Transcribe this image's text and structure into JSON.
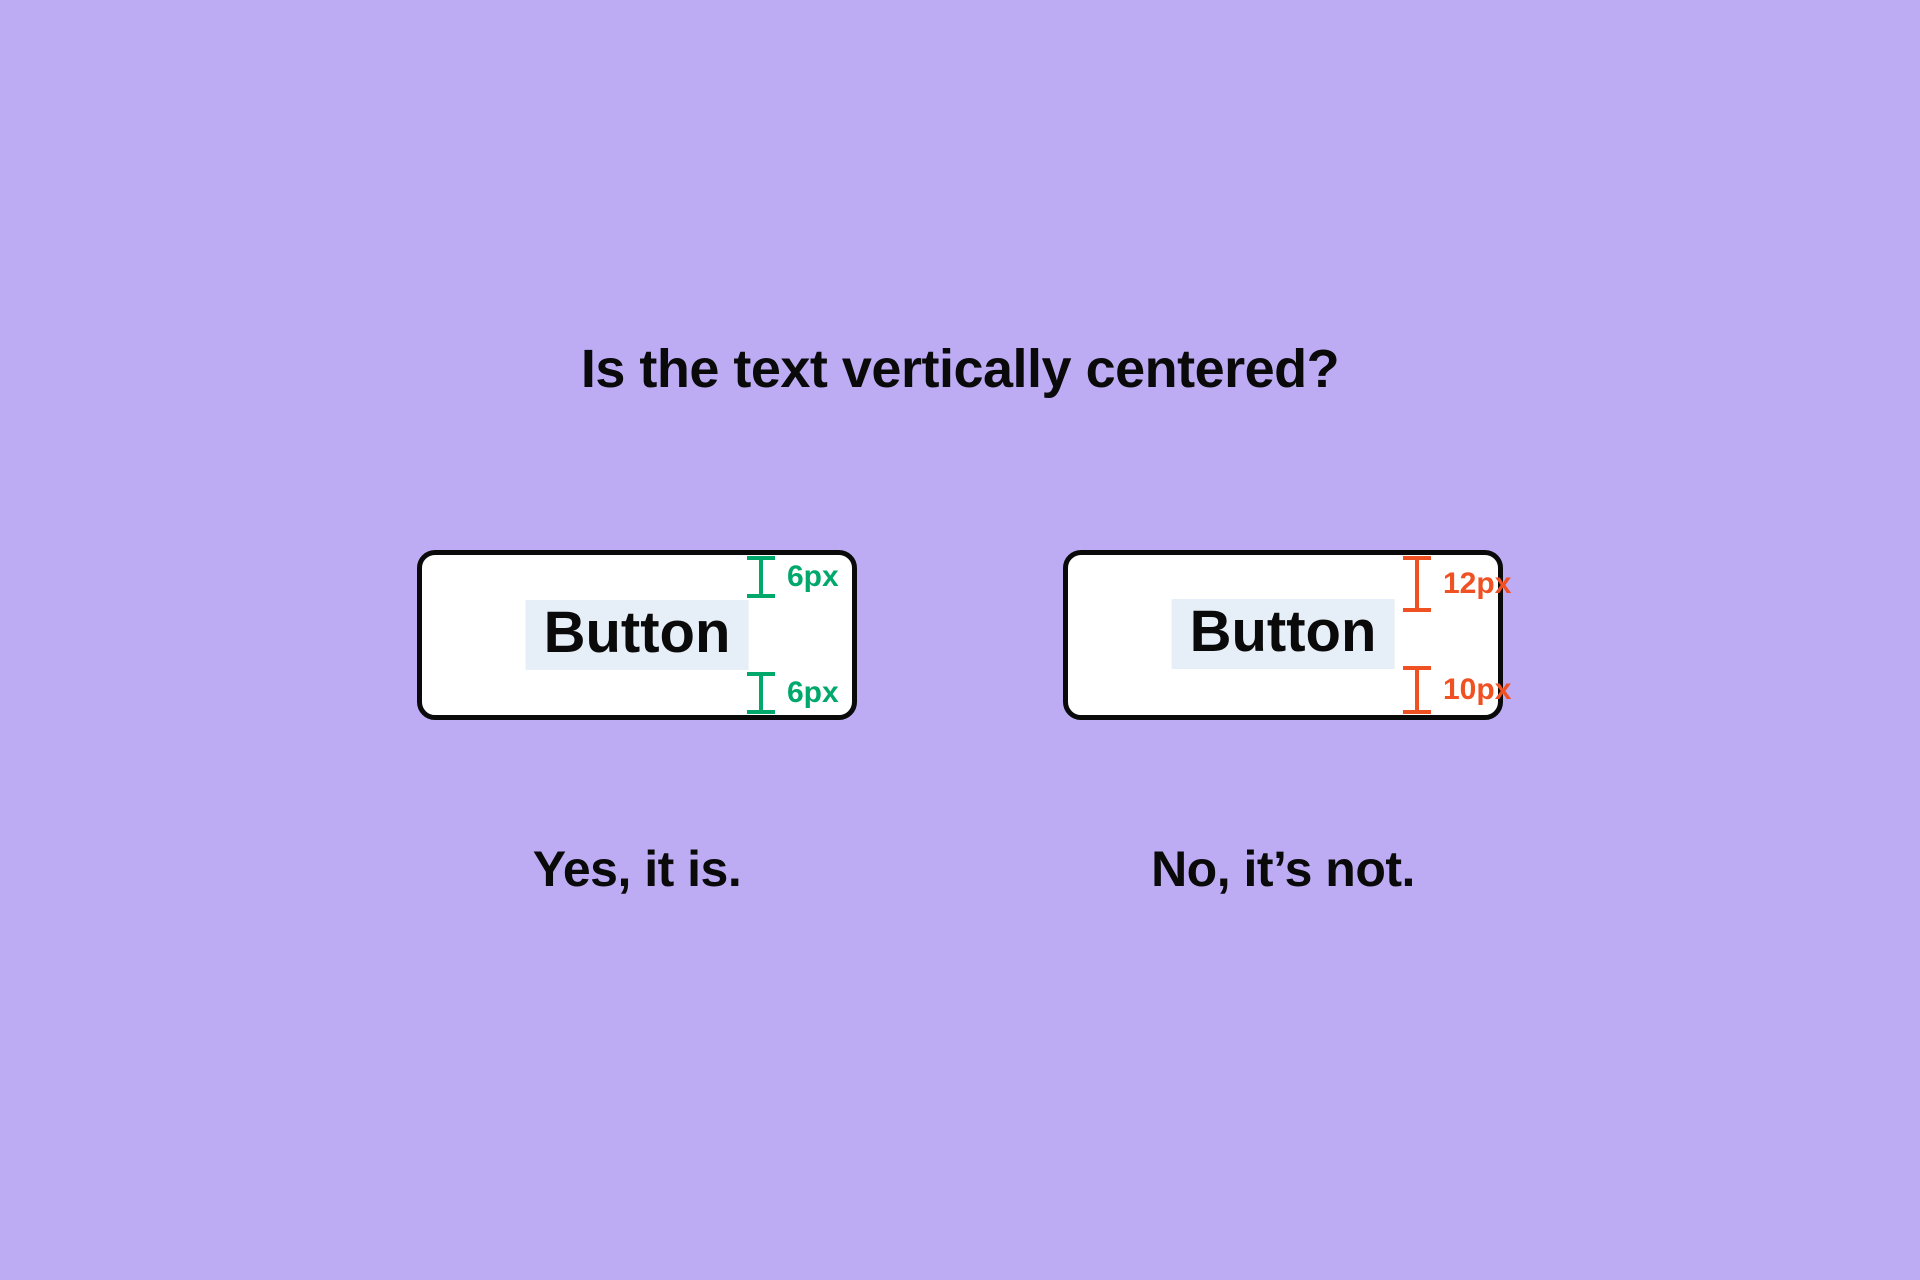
{
  "heading": "Is the text vertically centered?",
  "examples": {
    "left": {
      "button_label": "Button",
      "top_measure": "6px",
      "bottom_measure": "6px",
      "caption": "Yes, it is.",
      "measure_color": "green"
    },
    "right": {
      "button_label": "Button",
      "top_measure": "12px",
      "bottom_measure": "10px",
      "caption": "No, it’s not.",
      "measure_color": "red"
    }
  },
  "colors": {
    "background": "#bdacf4",
    "text": "#0a0a0a",
    "button_bg": "#ffffff",
    "button_border": "#0a0a0a",
    "highlight": "#e6eef7",
    "measure_green": "#00a86b",
    "measure_red": "#f05123"
  }
}
